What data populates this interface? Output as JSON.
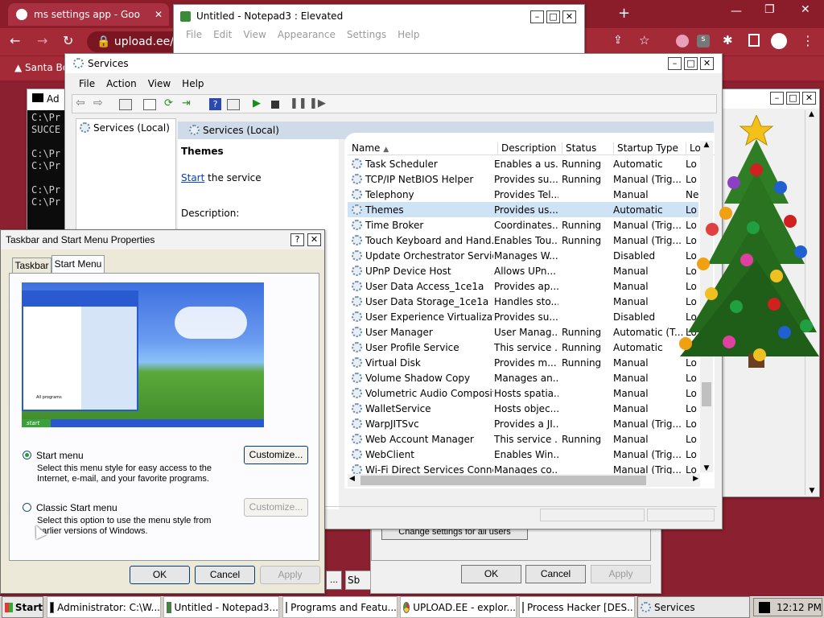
{
  "chrome": {
    "tab_title": "ms settings app - Goo",
    "url": "upload.ee/f",
    "bookmark": "Santa Bo"
  },
  "notepad": {
    "title": "Untitled - Notepad3 : Elevated",
    "menu": [
      "File",
      "Edit",
      "View",
      "Appearance",
      "Settings",
      "Help"
    ]
  },
  "cmd": {
    "title": "Ad",
    "lines": [
      "C:\\Pr",
      "SUCCE",
      "",
      "C:\\Pr",
      "C:\\Pr",
      "",
      "C:\\Pr",
      "C:\\Pr"
    ]
  },
  "services": {
    "title": "Services",
    "menu": [
      "File",
      "Action",
      "View",
      "Help"
    ],
    "tree_item": "Services (Local)",
    "header": "Services (Local)",
    "selected_name": "Themes",
    "start_link": "Start",
    "start_suffix": " the service",
    "description_label": "Description:",
    "columns": [
      "Name",
      "Description",
      "Status",
      "Startup Type",
      "Lo"
    ],
    "rows": [
      [
        "Task Scheduler",
        "Enables a us...",
        "Running",
        "Automatic",
        "Lo"
      ],
      [
        "TCP/IP NetBIOS Helper",
        "Provides su...",
        "Running",
        "Manual (Trig...",
        "Lo"
      ],
      [
        "Telephony",
        "Provides Tel...",
        "",
        "Manual",
        "Ne"
      ],
      [
        "Themes",
        "Provides us...",
        "",
        "Automatic",
        "Lo"
      ],
      [
        "Time Broker",
        "Coordinates...",
        "Running",
        "Manual (Trig...",
        "Lo"
      ],
      [
        "Touch Keyboard and Hand...",
        "Enables Tou...",
        "Running",
        "Manual (Trig...",
        "Lo"
      ],
      [
        "Update Orchestrator Service",
        "Manages W...",
        "",
        "Disabled",
        "Lo"
      ],
      [
        "UPnP Device Host",
        "Allows UPn...",
        "",
        "Manual",
        "Lo"
      ],
      [
        "User Data Access_1ce1a",
        "Provides ap...",
        "",
        "Manual",
        "Lo"
      ],
      [
        "User Data Storage_1ce1a",
        "Handles sto...",
        "",
        "Manual",
        "Lo"
      ],
      [
        "User Experience Virtualizati...",
        "Provides su...",
        "",
        "Disabled",
        "Lo"
      ],
      [
        "User Manager",
        "User Manag...",
        "Running",
        "Automatic (T...",
        "Lo"
      ],
      [
        "User Profile Service",
        "This service ...",
        "Running",
        "Automatic",
        "Lo"
      ],
      [
        "Virtual Disk",
        "Provides m...",
        "Running",
        "Manual",
        "Lo"
      ],
      [
        "Volume Shadow Copy",
        "Manages an...",
        "",
        "Manual",
        "Lo"
      ],
      [
        "Volumetric Audio Composit...",
        "Hosts spatia...",
        "",
        "Manual",
        "Lo"
      ],
      [
        "WalletService",
        "Hosts objec...",
        "",
        "Manual",
        "Lo"
      ],
      [
        "WarpJITSvc",
        "Provides a JI...",
        "",
        "Manual (Trig...",
        "Lo"
      ],
      [
        "Web Account Manager",
        "This service ...",
        "Running",
        "Manual",
        "Lo"
      ],
      [
        "WebClient",
        "Enables Win...",
        "",
        "Manual (Trig...",
        "Lo"
      ],
      [
        "Wi-Fi Direct Services Conne...",
        "Manages co...",
        "",
        "Manual (Trig...",
        "Lo"
      ]
    ]
  },
  "programs": {
    "change_settings": "Change settings for all users",
    "ok": "OK",
    "cancel": "Cancel",
    "apply": "Apply"
  },
  "taskbar_props": {
    "title": "Taskbar and Start Menu Properties",
    "tabs": [
      "Taskbar",
      "Start Menu"
    ],
    "opt1_label": "Start menu",
    "opt1_desc": "Select this menu style for easy access to the Internet, e-mail, and your favorite programs.",
    "opt1_button": "Customize...",
    "opt2_label": "Classic Start menu",
    "opt2_desc": "Select this option to use the menu style from earlier versions of Windows.",
    "opt2_button": "Customize...",
    "ok": "OK",
    "cancel": "Cancel",
    "apply": "Apply",
    "preview_start": "start",
    "preview_all_programs": "All programs"
  },
  "small_bits": {
    "dots": "...",
    "sb": "Sb"
  },
  "taskbar": {
    "start": "Start",
    "items": [
      "Administrator: C:\\W...",
      "Untitled - Notepad3...",
      "Programs and Featu...",
      "UPLOAD.EE - explor...",
      "Process Hacker [DES...",
      "Services"
    ],
    "clock": "12:12 PM"
  }
}
